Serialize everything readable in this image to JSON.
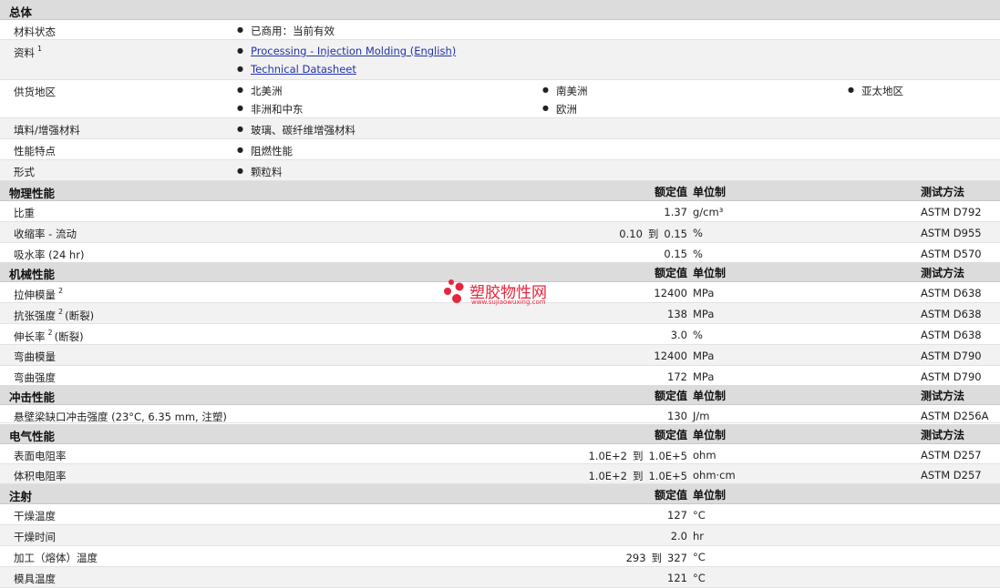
{
  "general": {
    "title": "总体",
    "status_label": "材料状态",
    "status_value": "已商用：当前有效",
    "docs_label": "资料",
    "docs_sup": "1",
    "docs": [
      "Processing - Injection Molding (English)",
      "Technical Datasheet"
    ],
    "supply_label": "供货地区",
    "supply": [
      "北美洲",
      "南美洲",
      "亚太地区",
      "非洲和中东",
      "欧洲"
    ],
    "filler_label": "填料/增强材料",
    "filler_value": "玻璃、碳纤维增强材料",
    "features_label": "性能特点",
    "features_value": "阻燃性能",
    "form_label": "形式",
    "form_value": "颗粒料"
  },
  "physical": {
    "title": "物理性能",
    "h_value": "额定值",
    "h_unit": "单位制",
    "h_method": "测试方法",
    "rows": [
      {
        "label": "比重",
        "sup": "",
        "suffix": "",
        "v1": "",
        "to": "",
        "v2": "1.37",
        "unit": "g/cm³",
        "method": "ASTM D792"
      },
      {
        "label": "收缩率  - 流动",
        "sup": "",
        "suffix": "",
        "v1": "0.10",
        "to": "到",
        "v2": "0.15",
        "unit": "%",
        "method": "ASTM D955"
      },
      {
        "label": "吸水率  (24 hr)",
        "sup": "",
        "suffix": "",
        "v1": "",
        "to": "",
        "v2": "0.15",
        "unit": "%",
        "method": "ASTM D570"
      }
    ]
  },
  "mechanical": {
    "title": "机械性能",
    "h_value": "额定值",
    "h_unit": "单位制",
    "h_method": "测试方法",
    "rows": [
      {
        "label": "拉伸模量",
        "sup": "2",
        "suffix": "",
        "v1": "",
        "to": "",
        "v2": "12400",
        "unit": "MPa",
        "method": "ASTM D638"
      },
      {
        "label": "抗张强度",
        "sup": "2",
        "suffix": "(断裂)",
        "v1": "",
        "to": "",
        "v2": "138",
        "unit": "MPa",
        "method": "ASTM D638"
      },
      {
        "label": "伸长率",
        "sup": "2",
        "suffix": "(断裂)",
        "v1": "",
        "to": "",
        "v2": "3.0",
        "unit": "%",
        "method": "ASTM D638"
      },
      {
        "label": "弯曲模量",
        "sup": "",
        "suffix": "",
        "v1": "",
        "to": "",
        "v2": "12400",
        "unit": "MPa",
        "method": "ASTM D790"
      },
      {
        "label": "弯曲强度",
        "sup": "",
        "suffix": "",
        "v1": "",
        "to": "",
        "v2": "172",
        "unit": "MPa",
        "method": "ASTM D790"
      }
    ]
  },
  "impact": {
    "title": "冲击性能",
    "h_value": "额定值",
    "h_unit": "单位制",
    "h_method": "测试方法",
    "rows": [
      {
        "label": "悬壁梁缺口冲击强度  (23°C, 6.35 mm, 注塑)",
        "sup": "",
        "suffix": "",
        "v1": "",
        "to": "",
        "v2": "130",
        "unit": "J/m",
        "method": "ASTM D256A"
      }
    ]
  },
  "electrical": {
    "title": "电气性能",
    "h_value": "额定值",
    "h_unit": "单位制",
    "h_method": "测试方法",
    "rows": [
      {
        "label": "表面电阻率",
        "sup": "",
        "suffix": "",
        "v1": "1.0E+2",
        "to": "到",
        "v2": "1.0E+5",
        "unit": "ohm",
        "method": "ASTM D257"
      },
      {
        "label": "体积电阻率",
        "sup": "",
        "suffix": "",
        "v1": "1.0E+2",
        "to": "到",
        "v2": "1.0E+5",
        "unit": "ohm·cm",
        "method": "ASTM D257"
      }
    ]
  },
  "injection": {
    "title": "注射",
    "h_value": "额定值",
    "h_unit": "单位制",
    "rows": [
      {
        "label": "干燥温度",
        "sup": "",
        "suffix": "",
        "v1": "",
        "to": "",
        "v2": "127",
        "unit": "°C",
        "method": ""
      },
      {
        "label": "干燥时间",
        "sup": "",
        "suffix": "",
        "v1": "",
        "to": "",
        "v2": "2.0",
        "unit": "hr",
        "method": ""
      },
      {
        "label": "加工（熔体）温度",
        "sup": "",
        "suffix": "",
        "v1": "293",
        "to": "到",
        "v2": "327",
        "unit": "°C",
        "method": ""
      },
      {
        "label": "模具温度",
        "sup": "",
        "suffix": "",
        "v1": "",
        "to": "",
        "v2": "121",
        "unit": "°C",
        "method": ""
      }
    ]
  },
  "watermark": {
    "text": "塑胶物性网",
    "url": "www.sujiaowuxing.com",
    "color": "#e8243c"
  }
}
